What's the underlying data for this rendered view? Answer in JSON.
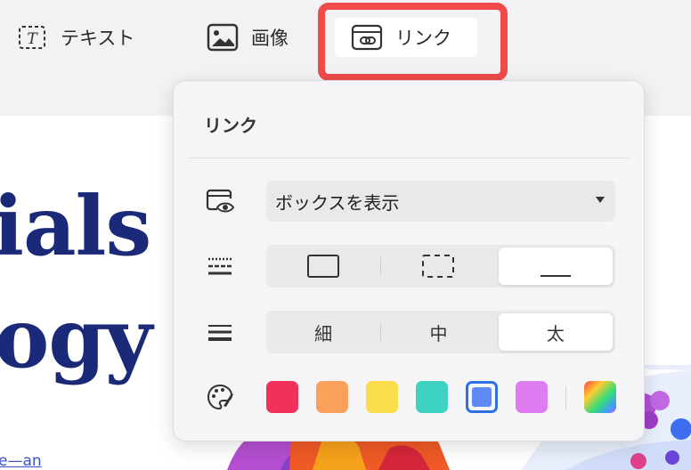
{
  "toolbar": {
    "text_label": "テキスト",
    "image_label": "画像",
    "link_label": "リンク"
  },
  "background": {
    "word1": "ials",
    "word2": "ogy",
    "link_fragment": "e—an"
  },
  "popover": {
    "title": "リンク",
    "display_select": {
      "value": "ボックスを表示"
    },
    "border_style_options": [
      "solid",
      "dashed",
      "underline"
    ],
    "border_style_selected": "underline",
    "weight_options": [
      {
        "label": "細",
        "selected": false
      },
      {
        "label": "中",
        "selected": false
      },
      {
        "label": "太",
        "selected": true
      }
    ],
    "colors": [
      {
        "name": "red",
        "hex": "#f2305c"
      },
      {
        "name": "orange",
        "hex": "#f9a05a"
      },
      {
        "name": "yellow",
        "hex": "#fbdc49"
      },
      {
        "name": "teal",
        "hex": "#3ed3c1"
      },
      {
        "name": "blue",
        "hex": "#5f8af5",
        "selected": true
      },
      {
        "name": "violet",
        "hex": "#df7cf2"
      },
      {
        "name": "custom-gradient",
        "hex": "gradient"
      }
    ]
  },
  "accent_color": "#f04a4a"
}
